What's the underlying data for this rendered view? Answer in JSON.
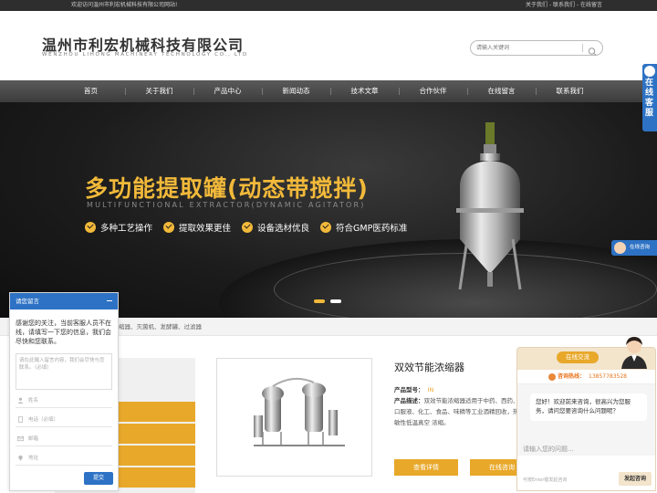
{
  "topbar": {
    "welcome": "欢迎访问温州市利宏机械科技有限公司网站!",
    "links": "关于我们 - 联系我们 - 在线留言"
  },
  "header": {
    "company_name": "温州市利宏机械科技有限公司",
    "company_name_en": "WENZHOU LIHONG MACHINERY TECHNOLOGY CO., LTD",
    "search_placeholder": "请输入关键词",
    "search_icon": "search-icon"
  },
  "nav": {
    "items": [
      "首页",
      "关于我们",
      "产品中心",
      "新闻动态",
      "技术文章",
      "合作伙伴",
      "在线留言",
      "联系我们"
    ]
  },
  "banner": {
    "title": "多功能提取罐(动态带搅拌)",
    "subtitle": "MULTIFUNCTIONAL EXTRACTOR(DYNAMIC AGITATOR)",
    "features": [
      "多种工艺操作",
      "提取效果更佳",
      "设备选材优良",
      "符合GMP医药标准"
    ],
    "accent_color": "#f2b93a",
    "active_slide": 1,
    "slide_count": 2
  },
  "breadcrumb": {
    "text": "缩器、灭菌机、发酵罐、过滤器"
  },
  "product": {
    "title": "双效节能浓缩器",
    "model_label": "产品型号：",
    "model_value": "IN",
    "desc_label": "产品描述：",
    "desc_text": "双效节能浓缩器适用于中药、西药、口服液、化工、食品、味精等工业酒精回收，热敏性低温真空 浓缩。",
    "btn_detail": "查看详情",
    "btn_consult": "在线咨询"
  },
  "service_tab": {
    "label": "在线客服",
    "mini_label": "在线咨询"
  },
  "message_widget": {
    "title": "请您留言",
    "intro": "感谢您的关注，当前客服人员不在线，请填写一下您的信息，我们会尽快和您联系。",
    "textarea_placeholder": "请在此输入留言内容，我们会尽快与您联系。（必填）",
    "fields": [
      "姓名",
      "电话（必填）",
      "邮箱",
      "地址"
    ],
    "submit": "提交"
  },
  "chat_widget": {
    "tab": "在线交流",
    "hotline_label": "咨询热线：",
    "hotline_number": "13857783528",
    "greeting": "您好！欢迎前来咨询，很高兴为您服务，请问您要咨询什么问题呢？",
    "input_placeholder": "请输入您的问题...",
    "footer_hint": "可按Enter键发起咨询",
    "send": "发起咨询"
  },
  "colors": {
    "brand_blue": "#2d72c4",
    "brand_gold": "#e8a82a",
    "nav_gray": "#4a4a4a"
  }
}
